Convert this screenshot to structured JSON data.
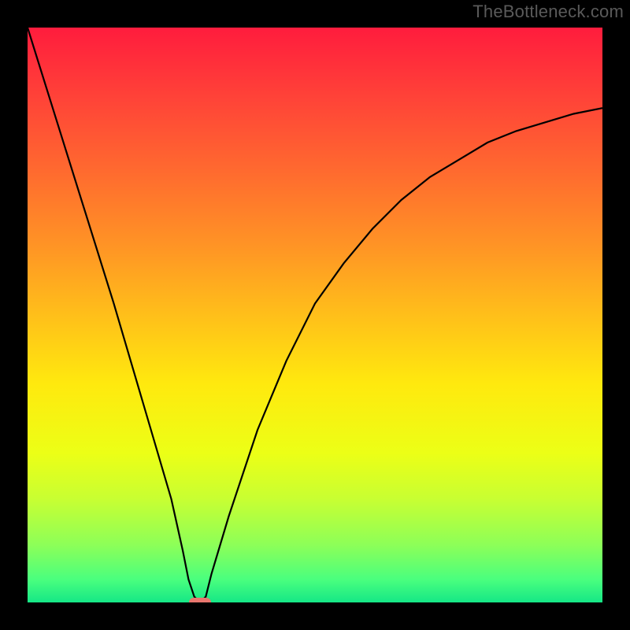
{
  "watermark": "TheBottleneck.com",
  "chart_data": {
    "type": "line",
    "title": "",
    "xlabel": "",
    "ylabel": "",
    "xlim": [
      0,
      100
    ],
    "ylim": [
      0,
      100
    ],
    "grid": false,
    "legend": null,
    "background_gradient": {
      "stops": [
        {
          "offset": 0.0,
          "color": "#ff1c3d"
        },
        {
          "offset": 0.12,
          "color": "#ff4238"
        },
        {
          "offset": 0.25,
          "color": "#ff6a2f"
        },
        {
          "offset": 0.38,
          "color": "#ff9425"
        },
        {
          "offset": 0.5,
          "color": "#ffbf1a"
        },
        {
          "offset": 0.62,
          "color": "#ffe90e"
        },
        {
          "offset": 0.74,
          "color": "#ecff16"
        },
        {
          "offset": 0.82,
          "color": "#c8ff32"
        },
        {
          "offset": 0.9,
          "color": "#8dff58"
        },
        {
          "offset": 0.96,
          "color": "#4aff7e"
        },
        {
          "offset": 1.0,
          "color": "#15e786"
        }
      ]
    },
    "series": [
      {
        "name": "bottleneck-curve",
        "color": "#000000",
        "x": [
          0,
          5,
          10,
          15,
          20,
          25,
          27,
          28,
          29,
          30,
          31,
          32,
          35,
          40,
          45,
          50,
          55,
          60,
          65,
          70,
          75,
          80,
          85,
          90,
          95,
          100
        ],
        "y": [
          100,
          84,
          68,
          52,
          35,
          18,
          9,
          4,
          1,
          0,
          1,
          5,
          15,
          30,
          42,
          52,
          59,
          65,
          70,
          74,
          77,
          80,
          82,
          83.5,
          85,
          86
        ]
      }
    ],
    "markers": [
      {
        "name": "optimal-point",
        "x": 30,
        "y": 0,
        "color": "#e8766e"
      }
    ]
  }
}
